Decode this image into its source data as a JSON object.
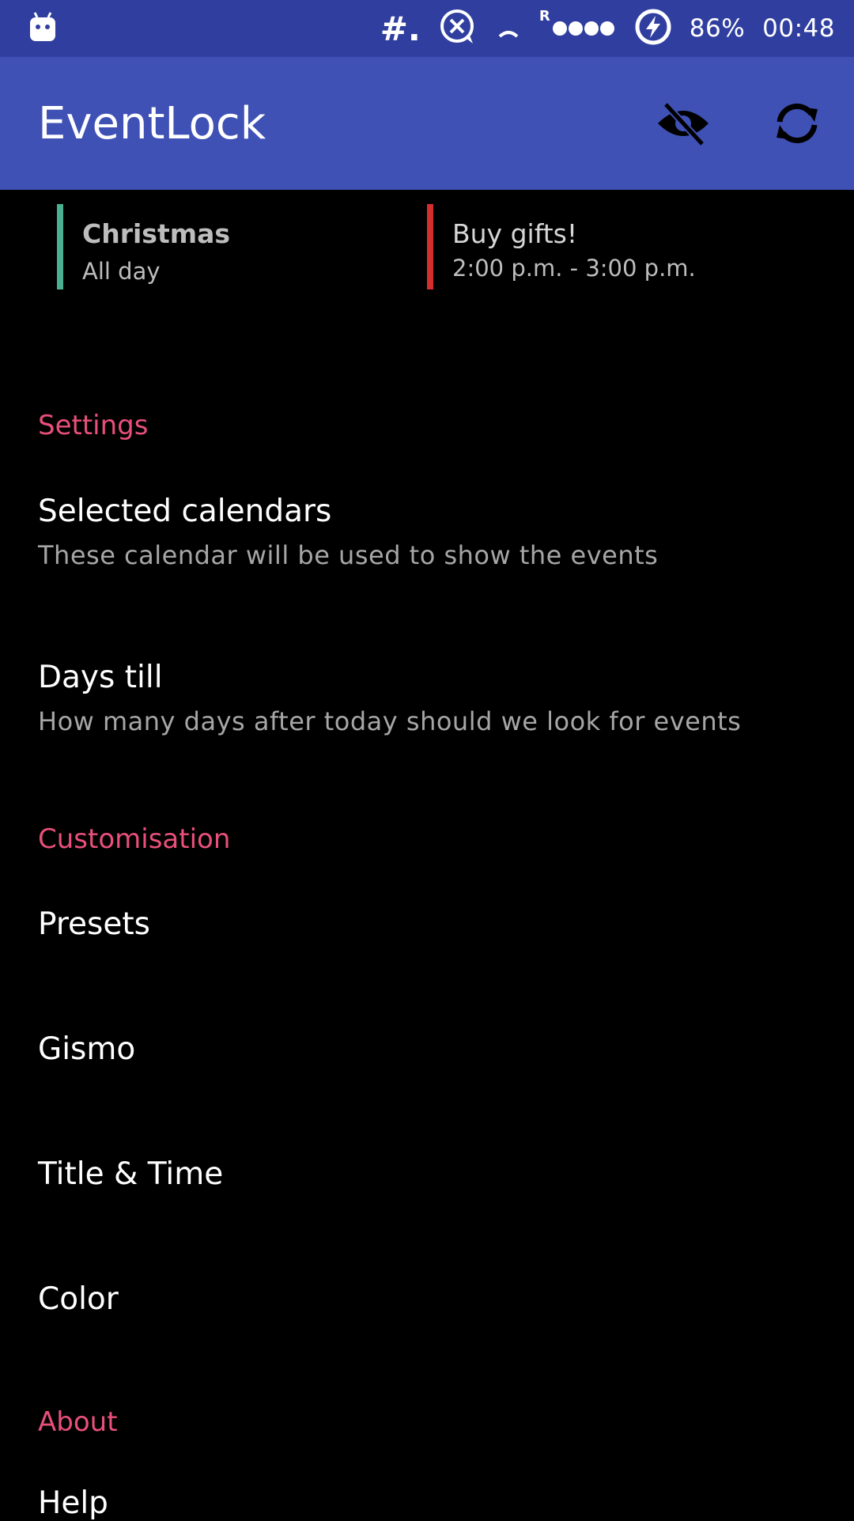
{
  "status_bar": {
    "battery": "86%",
    "time": "00:48",
    "hash_label": "#.",
    "roaming": "R",
    "icons": [
      "android-icon",
      "hash-icon",
      "blocked-message-icon",
      "wifi-icon",
      "signal-icon",
      "battery-charging-icon"
    ]
  },
  "app_bar": {
    "title": "EventLock",
    "actions": [
      "visibility-off-icon",
      "sync-icon"
    ]
  },
  "events": [
    {
      "title": "Christmas",
      "subtitle": "All day",
      "color": "#4caf90"
    },
    {
      "title": "Buy gifts!",
      "subtitle": "2:00 p.m. - 3:00 p.m.",
      "color": "#d32f2f"
    }
  ],
  "settings": {
    "header": "Settings",
    "selected_calendars": {
      "title": "Selected calendars",
      "summary": "These calendar will be used to show the events"
    },
    "days_till": {
      "title": "Days till",
      "summary": "How many days after today should we look for events"
    }
  },
  "customisation": {
    "header": "Customisation",
    "items": [
      "Presets",
      "Gismo",
      "Title & Time",
      "Color"
    ]
  },
  "about": {
    "header": "About",
    "items": [
      "Help"
    ]
  },
  "colors": {
    "status_bar": "#303f9f",
    "app_bar": "#3f51b5",
    "section_header": "#e8507a",
    "background": "#000000"
  }
}
